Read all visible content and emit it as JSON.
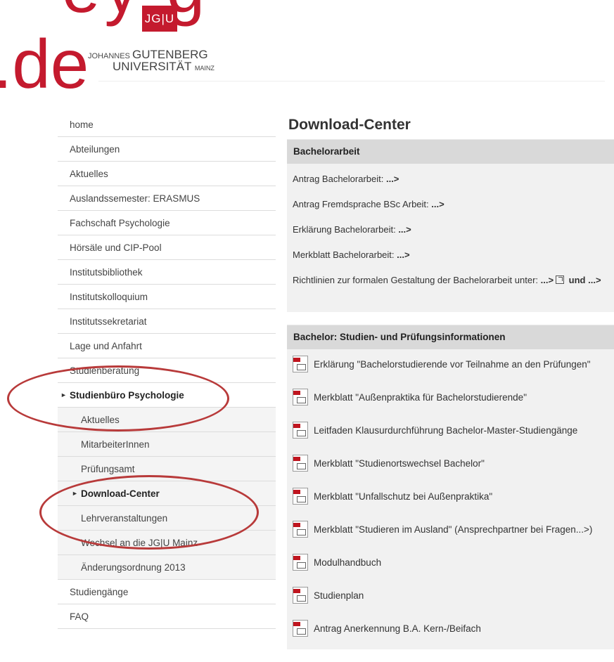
{
  "banner": {
    "big_text_top": "ey g",
    "big_text_domain": ".de",
    "logo_box": "JG|U",
    "logo_line1_small": "JOHANNES",
    "logo_line1": "GUTENBERG",
    "logo_line2": "UNIVERSITÄT",
    "logo_line2_small": "MAINZ"
  },
  "sidebar": {
    "items": [
      {
        "label": "home"
      },
      {
        "label": "Abteilungen"
      },
      {
        "label": "Aktuelles"
      },
      {
        "label": "Auslandssemester: ERASMUS"
      },
      {
        "label": "Fachschaft Psychologie"
      },
      {
        "label": "Hörsäle und CIP-Pool"
      },
      {
        "label": "Institutsbibliothek"
      },
      {
        "label": "Institutskolloquium"
      },
      {
        "label": "Institutssekretariat"
      },
      {
        "label": "Lage und Anfahrt"
      },
      {
        "label": "Studienberatung"
      },
      {
        "label": "Studienbüro Psychologie"
      },
      {
        "label": "Aktuelles"
      },
      {
        "label": "MitarbeiterInnen"
      },
      {
        "label": "Prüfungsamt"
      },
      {
        "label": "Download-Center"
      },
      {
        "label": "Lehrveranstaltungen"
      },
      {
        "label": "Wechsel an die JG|U Mainz"
      },
      {
        "label": "Änderungsordnung 2013"
      },
      {
        "label": "Studiengänge"
      },
      {
        "label": "FAQ"
      }
    ]
  },
  "main": {
    "title": "Download-Center",
    "sections": [
      {
        "heading": "Bachelorarbeit",
        "rows": [
          {
            "text": "Antrag Bachelorarbeit: ",
            "link": "...>"
          },
          {
            "text": "Antrag Fremdsprache BSc Arbeit: ",
            "link": "...>"
          },
          {
            "text": "Erklärung Bachelorarbeit: ",
            "link": "...>"
          },
          {
            "text": "Merkblatt Bachelorarbeit: ",
            "link": "...>"
          },
          {
            "text": "Richtlinien zur formalen Gestaltung der Bachelorarbeit unter: ",
            "link": "...>",
            "after": " und ...>"
          }
        ]
      },
      {
        "heading": "Bachelor: Studien- und Prüfungsinformationen",
        "files": [
          {
            "label": "Erklärung \"Bachelorstudierende vor Teilnahme an den Prüfungen\""
          },
          {
            "label": "Merkblatt \"Außenpraktika für Bachelorstudierende\""
          },
          {
            "label": "Leitfaden Klausurdurchführung Bachelor-Master-Studiengänge"
          },
          {
            "label": "Merkblatt \"Studienortswechsel Bachelor\""
          },
          {
            "label": "Merkblatt \"Unfallschutz bei Außenpraktika\""
          },
          {
            "label": "Merkblatt \"Studieren im Ausland\" (Ansprechpartner bei Fragen...>)"
          },
          {
            "label": "Modulhandbuch"
          },
          {
            "label": "Studienplan"
          },
          {
            "label": "Antrag Anerkennung B.A. Kern-/Beifach"
          }
        ]
      }
    ]
  },
  "colors": {
    "brand": "#c41a2e",
    "annotation": "#b83a3a",
    "section_head": "#d9d9d9"
  }
}
